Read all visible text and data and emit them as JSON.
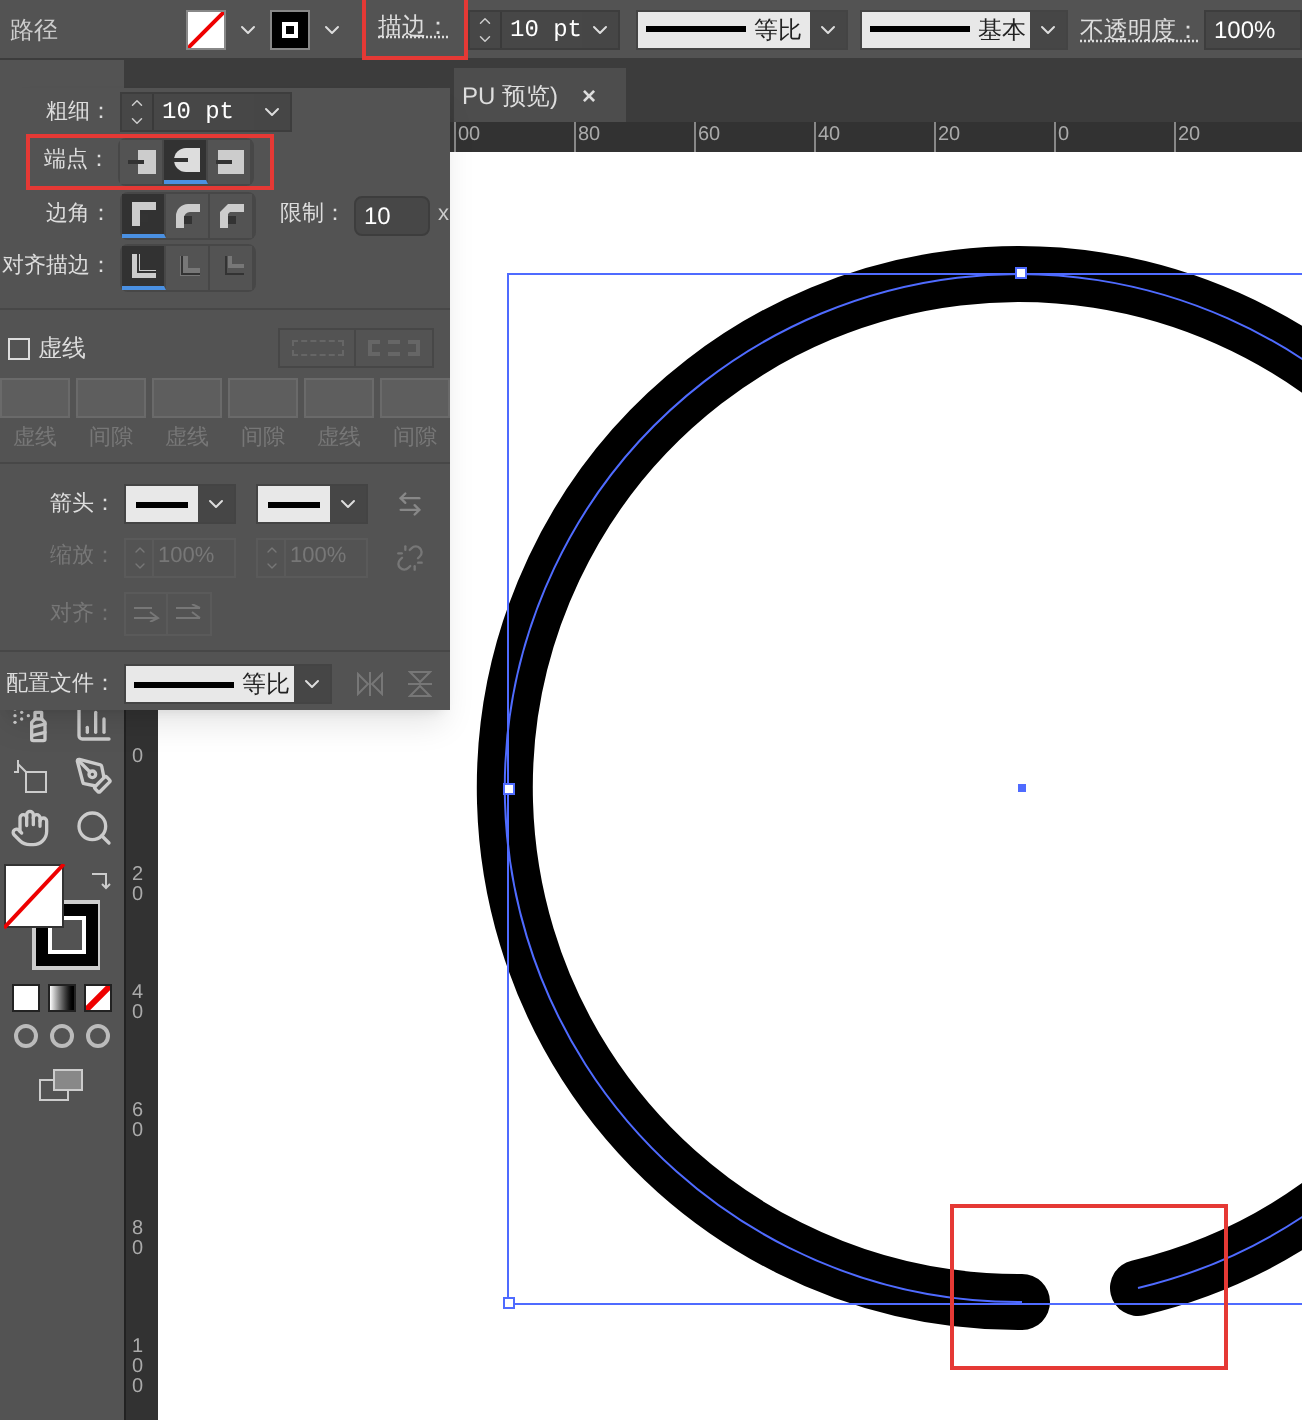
{
  "control_bar": {
    "object_type": "路径",
    "stroke_label": "描边：",
    "stroke_weight": "10 pt",
    "profile": "等比",
    "brush": "基本",
    "opacity_label": "不透明度：",
    "opacity": "100%"
  },
  "document_tab": {
    "title": "PU 预览)",
    "close": "×"
  },
  "horizontal_ruler": [
    "00",
    "80",
    "60",
    "40",
    "20",
    "0",
    "20"
  ],
  "vertical_ruler": [
    "0",
    "20",
    "40",
    "60",
    "80",
    "100"
  ],
  "stroke_panel": {
    "weight_label": "粗细：",
    "weight": "10 pt",
    "cap_label": "端点：",
    "caps": [
      {
        "selected": false
      },
      {
        "selected": true
      },
      {
        "selected": false
      }
    ],
    "corner_label": "边角：",
    "corners": [
      {
        "selected": true
      },
      {
        "selected": false
      },
      {
        "selected": false
      }
    ],
    "limit_label": "限制：",
    "limit": "10",
    "limit_unit": "x",
    "align_label": "对齐描边：",
    "aligns": [
      {
        "selected": true,
        "disabled": false
      },
      {
        "selected": false,
        "disabled": true
      },
      {
        "selected": false,
        "disabled": true
      }
    ],
    "dashed": {
      "label": "虚线",
      "checked": false
    },
    "dash_fields": [
      "虚线",
      "间隙",
      "虚线",
      "间隙",
      "虚线",
      "间隙"
    ],
    "arrow_label": "箭头：",
    "scale_label": "缩放：",
    "scale_start": "100%",
    "scale_end": "100%",
    "arrow_align_label": "对齐：",
    "profile_label": "配置文件：",
    "profile": "等比"
  }
}
